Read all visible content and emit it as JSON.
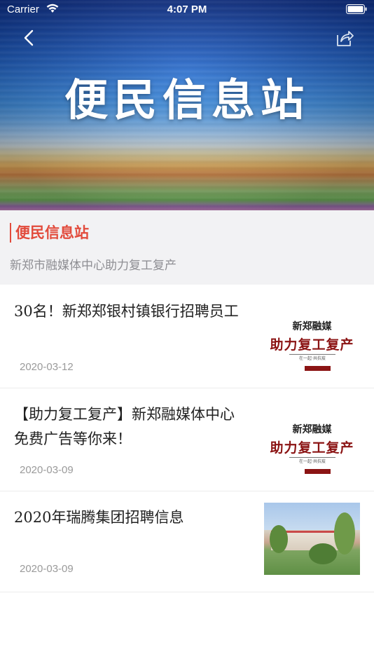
{
  "status_bar": {
    "carrier": "Carrier",
    "time": "4:07 PM"
  },
  "header": {
    "banner_title": "便民信息站",
    "back_icon": "chevron-left-icon",
    "share_icon": "share-icon"
  },
  "intro": {
    "title": "便民信息站",
    "subtitle": "新郑市融媒体中心助力复工复产",
    "accent_color": "#e24b3c"
  },
  "articles": [
    {
      "title": "30名！新郑郑银村镇银行招聘员工",
      "date": "2020-03-12",
      "thumbnail": {
        "type": "poster",
        "line1": "新郑融媒",
        "line2": "助力复工复产",
        "line3": "在一起·共抗疫"
      }
    },
    {
      "title": "【助力复工复产】新郑融媒体中心免费广告等你来！",
      "date": "2020-03-09",
      "thumbnail": {
        "type": "poster",
        "line1": "新郑融媒",
        "line2": "助力复工复产",
        "line3": "在一起·共抗疫"
      }
    },
    {
      "title": "2020年瑞腾集团招聘信息",
      "date": "2020-03-09",
      "thumbnail": {
        "type": "photo"
      }
    }
  ]
}
